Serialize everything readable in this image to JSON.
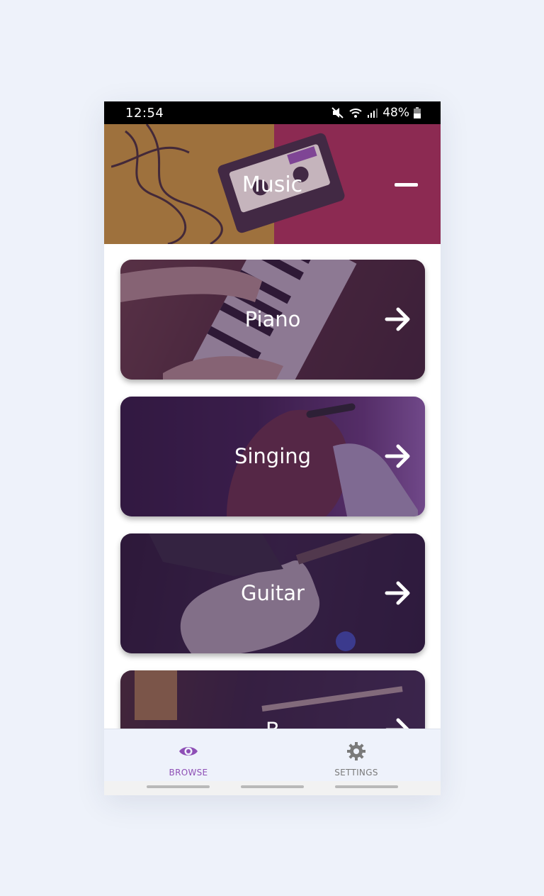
{
  "status_bar": {
    "time": "12:54",
    "battery": "48%",
    "icons": [
      "mute-icon",
      "wifi-icon",
      "signal-icon",
      "battery-icon"
    ]
  },
  "header": {
    "title": "Music",
    "collapse_icon": "minus-icon"
  },
  "categories": [
    {
      "label": "Piano",
      "icon": "arrow-right-icon"
    },
    {
      "label": "Singing",
      "icon": "arrow-right-icon"
    },
    {
      "label": "Guitar",
      "icon": "arrow-right-icon"
    },
    {
      "label": "B",
      "icon": "arrow-right-icon"
    }
  ],
  "bottom_nav": {
    "browse": {
      "label": "BROWSE",
      "icon": "eye-icon",
      "active": true
    },
    "settings": {
      "label": "SETTINGS",
      "icon": "gear-icon",
      "active": false
    }
  },
  "colors": {
    "accent": "#8e4fb6",
    "card_tint": "#3e2450",
    "page_bg": "#eef2fa"
  }
}
